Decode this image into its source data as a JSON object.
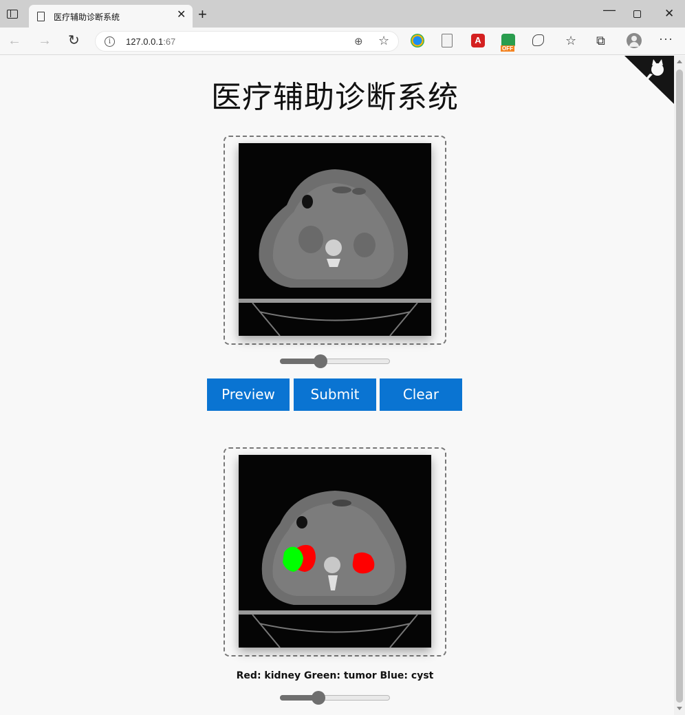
{
  "browser": {
    "tab_title": "医疗辅助诊断系统",
    "tab_close": "✕",
    "new_tab": "+",
    "url_host": "127.0.0.1",
    "url_port": ":67",
    "ext_pdf_label": "A",
    "ext_off_label": "OFF",
    "more_label": "···"
  },
  "page": {
    "title": "医疗辅助诊断系统",
    "input_slider_value": 0.35,
    "output_slider_value": 0.33,
    "buttons": {
      "preview": "Preview",
      "submit": "Submit",
      "clear": "Clear"
    },
    "legend": "Red: kidney Green: tumor Blue: cyst",
    "colors": {
      "button": "#0a74d2",
      "kidney": "#ff0000",
      "tumor": "#00ff00",
      "cyst": "#0000ff"
    }
  }
}
